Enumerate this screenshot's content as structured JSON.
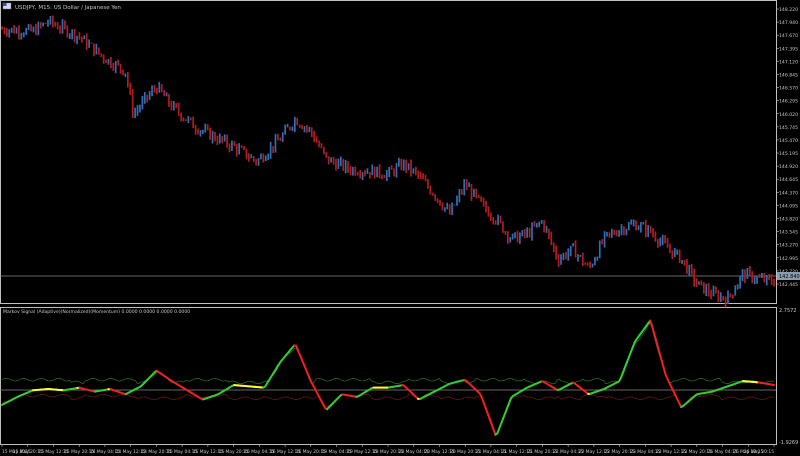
{
  "header": {
    "symbol_title": "USDJPY, M15:  US Dollar / Japanese Yen",
    "flag_icon": "us-flag-icon"
  },
  "price_axis": {
    "labels": [
      "148.220",
      "147.940",
      "147.670",
      "147.395",
      "147.120",
      "146.845",
      "146.570",
      "146.295",
      "146.020",
      "145.745",
      "145.470",
      "145.195",
      "144.920",
      "144.645",
      "144.370",
      "144.095",
      "143.820",
      "143.545",
      "143.270",
      "142.995",
      "142.720",
      "142.445"
    ],
    "current_price": "142.840"
  },
  "indicator": {
    "title": "Markov Signal (Adaptive)(Normalized)(Momentum) 0.0000 0.0000 0.0000 0.0000",
    "axis_top": "2.7572",
    "axis_bottom": "-1.9269"
  },
  "time_axis": {
    "labels": [
      "15 May 2025",
      "15 May 20:15",
      "15 May 12:15",
      "15 May 20:15",
      "14 May 04:15",
      "14 May 12:15",
      "14 May 20:15",
      "15 May 04:15",
      "15 May 12:15",
      "15 May 20:15",
      "16 May 04:15",
      "16 May 12:15",
      "16 May 20:15",
      "19 May 04:15",
      "19 May 12:15",
      "19 May 20:15",
      "20 May 04:15",
      "20 May 12:15",
      "20 May 20:15",
      "21 May 04:15",
      "21 May 12:15",
      "21 May 20:15",
      "22 May 04:15",
      "22 May 12:15",
      "22 May 20:15",
      "23 May 04:15",
      "23 May 12:15",
      "23 May 20:15",
      "26 May 04:15",
      "26 May 12:15",
      "26 May 20:15"
    ]
  },
  "colors": {
    "bull": "#2f6fb5",
    "bear": "#b01e1e",
    "signal_up": "#33cc33",
    "signal_mid": "#ffff33",
    "signal_down": "#ee2020",
    "band_upper": "#1f6b1f",
    "band_lower": "#6b1515",
    "axis": "#bfbfbf",
    "grid": "#8a8a8a"
  },
  "chart_data": {
    "type": "line",
    "title": "USDJPY, M15:  US Dollar / Japanese Yen",
    "ylim": [
      142.42,
      148.3
    ],
    "price_path_x": [
      0,
      0.04,
      0.06,
      0.1,
      0.13,
      0.16,
      0.17,
      0.2,
      0.22,
      0.25,
      0.28,
      0.3,
      0.33,
      0.36,
      0.38,
      0.4,
      0.42,
      0.45,
      0.48,
      0.5,
      0.52,
      0.54,
      0.56,
      0.58,
      0.6,
      0.62,
      0.64,
      0.66,
      0.68,
      0.7,
      0.72,
      0.74,
      0.76,
      0.78,
      0.8,
      0.82,
      0.84,
      0.86,
      0.88,
      0.9,
      0.92,
      0.94,
      0.96,
      0.98,
      1.0
    ],
    "price_path_y": [
      147.9,
      147.85,
      148.05,
      147.75,
      147.35,
      147.05,
      146.2,
      146.75,
      146.35,
      145.95,
      145.7,
      145.55,
      145.25,
      145.7,
      146.1,
      145.85,
      145.3,
      145.1,
      145.05,
      145.0,
      145.2,
      144.95,
      144.6,
      144.2,
      144.8,
      144.4,
      144.1,
      143.7,
      143.8,
      144.05,
      143.3,
      143.5,
      143.1,
      143.7,
      143.9,
      144.0,
      143.85,
      143.55,
      143.3,
      142.8,
      142.6,
      142.5,
      143.0,
      142.9,
      142.85
    ],
    "signal_x": [
      0,
      0.02,
      0.04,
      0.06,
      0.08,
      0.1,
      0.12,
      0.14,
      0.16,
      0.18,
      0.2,
      0.22,
      0.24,
      0.26,
      0.28,
      0.3,
      0.32,
      0.34,
      0.36,
      0.38,
      0.4,
      0.42,
      0.44,
      0.46,
      0.48,
      0.5,
      0.52,
      0.54,
      0.56,
      0.58,
      0.6,
      0.62,
      0.64,
      0.66,
      0.68,
      0.7,
      0.72,
      0.74,
      0.76,
      0.78,
      0.8,
      0.82,
      0.84,
      0.86,
      0.88,
      0.9,
      0.92,
      0.94,
      0.96,
      0.98,
      1.0
    ],
    "signal_y": [
      -0.6,
      -0.3,
      -0.05,
      0.0,
      -0.05,
      0.05,
      -0.1,
      0.0,
      -0.2,
      0.1,
      0.7,
      0.3,
      -0.05,
      -0.4,
      -0.2,
      0.15,
      0.1,
      0.05,
      1.0,
      1.7,
      0.3,
      -0.8,
      -0.2,
      -0.3,
      0.05,
      0.05,
      0.15,
      -0.4,
      -0.1,
      0.2,
      0.35,
      -0.2,
      -1.8,
      -0.3,
      0.05,
      0.3,
      -0.05,
      0.25,
      -0.2,
      0.0,
      0.3,
      1.8,
      2.6,
      0.5,
      -0.7,
      -0.2,
      -0.1,
      0.1,
      0.3,
      0.25,
      0.15
    ],
    "signal_ylim": [
      -1.9269,
      2.7572
    ]
  }
}
